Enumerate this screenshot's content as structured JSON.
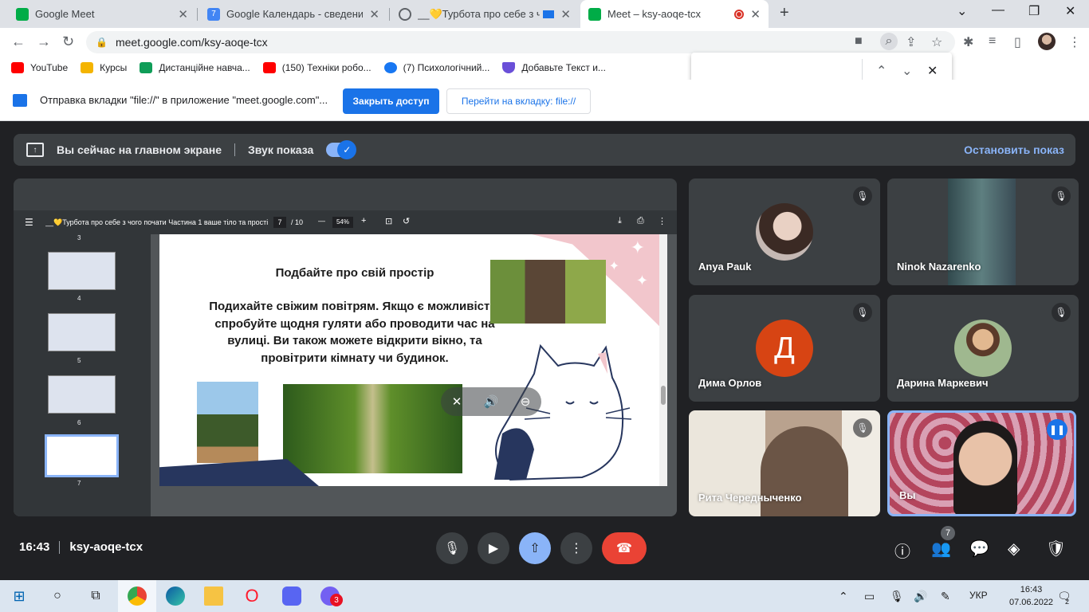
{
  "browser": {
    "tabs": [
      {
        "title": "Google Meet",
        "color": "#00ac47"
      },
      {
        "title": "Google Календарь - сведения о",
        "color": "#4285f4"
      },
      {
        "title": "__💛Турбота про себе з чо",
        "color": "#5f6368"
      },
      {
        "title": "Meet – ksy-aoqe-tcx",
        "color": "#00ac47"
      }
    ],
    "url": "meet.google.com/ksy-aoqe-tcx",
    "bookmarks": [
      {
        "label": "YouTube",
        "color": "#ff0000"
      },
      {
        "label": "Курсы",
        "color": "#f4b400"
      },
      {
        "label": "Дистанційне навча...",
        "color": "#0f9d58"
      },
      {
        "label": "(150) Техніки робо...",
        "color": "#ff0000"
      },
      {
        "label": "(7) Психологічний...",
        "color": "#1877f2"
      },
      {
        "label": "Добавьте Текст и...",
        "color": "#6a4fd8"
      }
    ],
    "infobar": {
      "message": "Отправка вкладки \"file://\" в приложение \"meet.google.com\"...",
      "primary_button": "Закрыть доступ",
      "secondary_button": "Перейти на вкладку: file://"
    }
  },
  "meet": {
    "presenting": {
      "status": "Вы сейчас на главном экране",
      "sound_label": "Звук показа",
      "stop_label": "Остановить показ"
    },
    "pdf": {
      "title": "__💛Турбота про себе з чого почати Частина 1 ваше тіло та прості...",
      "page": "7",
      "page_total": "/ 10",
      "zoom": "54%",
      "thumbnails": [
        "3",
        "4",
        "5",
        "6",
        "7"
      ],
      "slide_heading": "Подбайте про свій  простір",
      "slide_text": "Подихайте свіжим повітрям. Якщо є можливість, спробуйте щодня гуляти або проводити час на вулиці. Ви також можете відкрити вікно, та провітрити кімнату чи будинок."
    },
    "participants": [
      {
        "name": "Anya Pauk"
      },
      {
        "name": "Ninok Nazarenko"
      },
      {
        "name": "Дима Орлов",
        "initial": "Д",
        "color": "#d74413"
      },
      {
        "name": "Дарина Маркевич"
      },
      {
        "name": "Рита Чередныченко"
      },
      {
        "name": "Вы"
      }
    ],
    "meeting": {
      "time": "16:43",
      "code": "ksy-aoqe-tcx",
      "people_count": "7"
    }
  },
  "taskbar": {
    "lang": "УКР",
    "time": "16:43",
    "date": "07.06.2022",
    "viber_badge": "3",
    "notifications": "2"
  }
}
